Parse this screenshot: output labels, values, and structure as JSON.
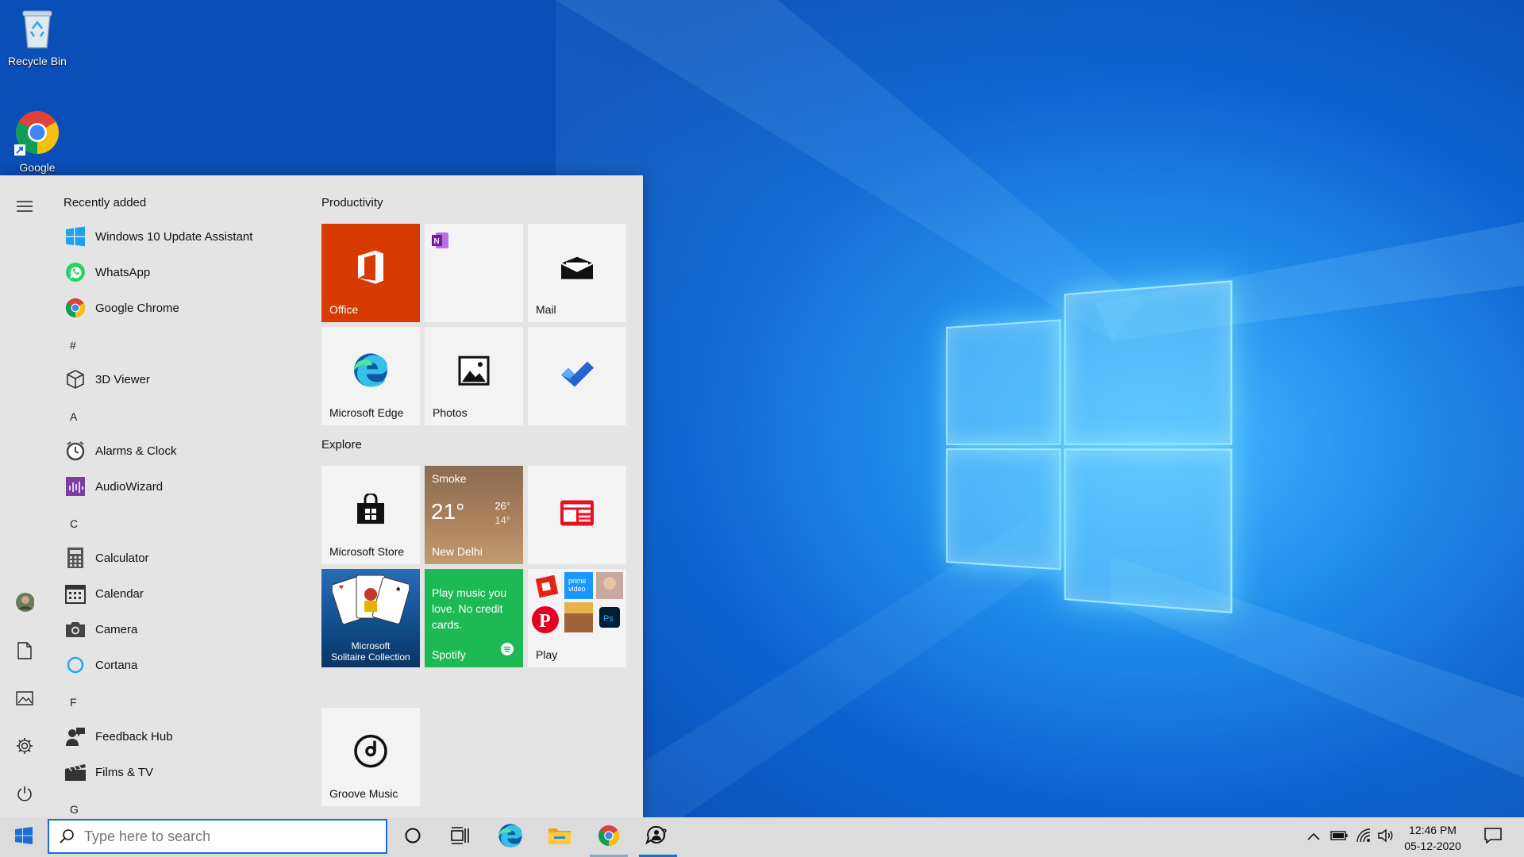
{
  "desktop": {
    "icons": [
      {
        "label": "Recycle Bin"
      },
      {
        "label": "Google"
      }
    ]
  },
  "start": {
    "app_list": {
      "recently_added_header": "Recently added",
      "recent": [
        {
          "label": "Windows 10 Update Assistant",
          "icon": "windows-icon"
        },
        {
          "label": "WhatsApp",
          "icon": "whatsapp-icon"
        },
        {
          "label": "Google Chrome",
          "icon": "chrome-icon"
        }
      ],
      "letters": [
        "#",
        "A",
        "C",
        "F",
        "G"
      ],
      "apps": [
        {
          "label": "3D Viewer",
          "icon": "cube-icon"
        },
        {
          "label": "Alarms & Clock",
          "icon": "clock-icon"
        },
        {
          "label": "AudioWizard",
          "icon": "audio-icon"
        },
        {
          "label": "Calculator",
          "icon": "calculator-icon"
        },
        {
          "label": "Calendar",
          "icon": "calendar-icon"
        },
        {
          "label": "Camera",
          "icon": "camera-icon"
        },
        {
          "label": "Cortana",
          "icon": "cortana-icon"
        },
        {
          "label": "Feedback Hub",
          "icon": "feedback-icon"
        },
        {
          "label": "Films & TV",
          "icon": "film-icon"
        }
      ]
    },
    "groups": {
      "productivity": "Productivity",
      "explore": "Explore"
    },
    "tiles": {
      "office": "Office",
      "mail": "Mail",
      "edge": "Microsoft Edge",
      "photos": "Photos",
      "store": "Microsoft Store",
      "weather": {
        "condition": "Smoke",
        "temp": "21°",
        "high": "26°",
        "low": "14°",
        "city": "New Delhi"
      },
      "solitaire": "Microsoft\nSolitaire Collection",
      "spotify": {
        "text": "Play music you love. No credit cards.",
        "label": "Spotify"
      },
      "play": "Play",
      "groove": "Groove Music"
    }
  },
  "taskbar": {
    "search_placeholder": "Type here to search",
    "time": "12:46 PM",
    "date": "05-12-2020"
  },
  "colors": {
    "office_tile": "#d83b01",
    "weather_tile": "#a97f5b",
    "spotify_tile": "#1db954",
    "solitaire_tile": "#0f4c8a",
    "accent": "#1a6fd6"
  }
}
